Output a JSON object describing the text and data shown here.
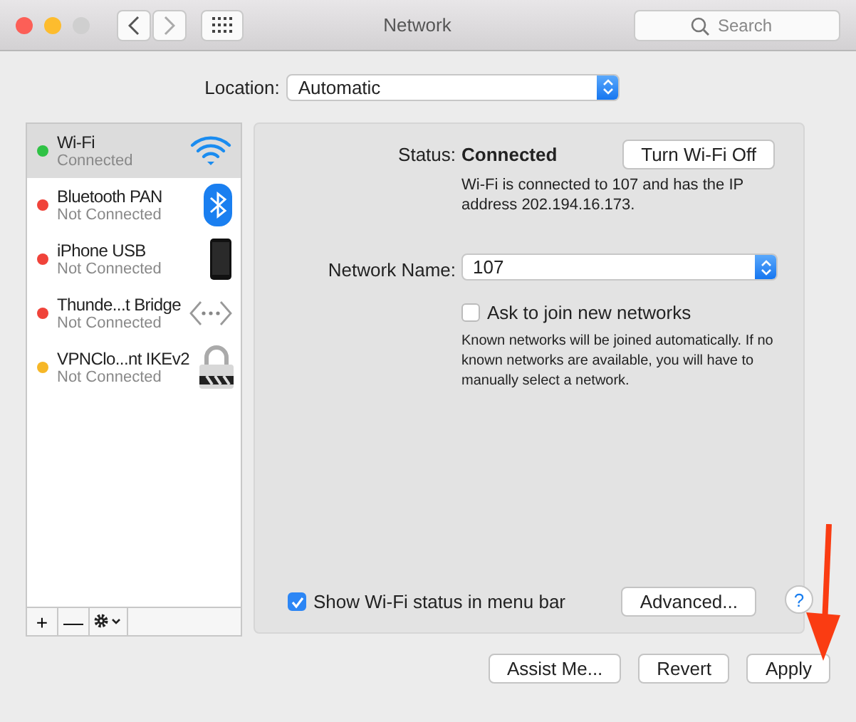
{
  "window": {
    "title": "Network",
    "search": {
      "placeholder": "Search"
    }
  },
  "location": {
    "label": "Location:",
    "value": "Automatic"
  },
  "services": [
    {
      "name": "Wi-Fi",
      "status": "Connected",
      "color": "#2fc245",
      "selected": true,
      "kind": "wifi"
    },
    {
      "name": "Bluetooth PAN",
      "status": "Not Connected",
      "color": "#f0433a",
      "selected": false,
      "kind": "bluetooth"
    },
    {
      "name": "iPhone USB",
      "status": "Not Connected",
      "color": "#f0433a",
      "selected": false,
      "kind": "phone"
    },
    {
      "name": "Thunde...t Bridge",
      "status": "Not Connected",
      "color": "#f0433a",
      "selected": false,
      "kind": "bridge"
    },
    {
      "name": "VPNClo...nt IKEv2",
      "status": "Not Connected",
      "color": "#f6b727",
      "selected": false,
      "kind": "vpn"
    }
  ],
  "list_toolbar": [
    "+",
    "—"
  ],
  "detail": {
    "status_label": "Status:",
    "status_value": "Connected",
    "toggle_button": "Turn Wi-Fi Off",
    "status_note": "Wi-Fi is connected to 107 and has the IP address 202.194.16.173.",
    "network_label": "Network Name:",
    "network_value": "107",
    "ask": {
      "label": "Ask to join new networks",
      "checked": false
    },
    "ask_note": "Known networks will be joined automatically. If no known networks are available, you will have to manually select a network.",
    "show_status": {
      "label": "Show Wi-Fi status in menu bar",
      "checked": true
    },
    "advanced_button": "Advanced...",
    "help": "?"
  },
  "buttons": [
    "Assist Me...",
    "Revert",
    "Apply"
  ]
}
